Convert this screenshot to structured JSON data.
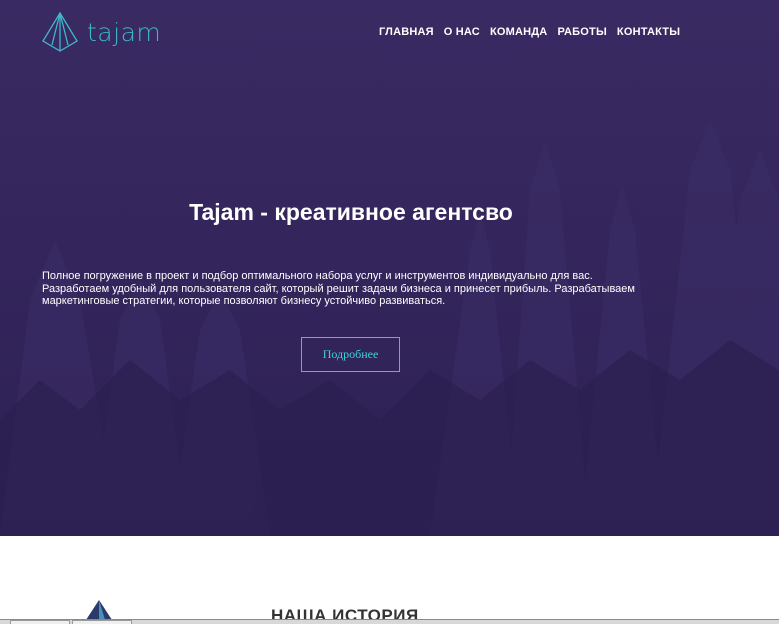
{
  "brand": {
    "name": "tajam",
    "accent": "#3fb7c9"
  },
  "nav": {
    "items": [
      {
        "label": "ГЛАВНАЯ"
      },
      {
        "label": "О НАС"
      },
      {
        "label": "КОМАНДА"
      },
      {
        "label": "РАБОТЫ"
      },
      {
        "label": "КОНТАКТЫ"
      }
    ]
  },
  "hero": {
    "title": "Tajam - креативное агентсво",
    "line1": "Полное погружение в проект и подбор оптимального набора услуг и инструментов индивидуально для вас.",
    "line2": "Разработаем удобный для пользователя сайт, который решит задачи бизнеса и принесет прибыль. Разрабатываем",
    "line3": "маркетинговые стратегии, которые позволяют бизнесу устойчиво развиваться.",
    "cta": "Подробнее",
    "background_color": "#34265c",
    "cta_color": "#2fc6d0"
  },
  "story": {
    "title": "НАША ИСТОРИЯ"
  }
}
